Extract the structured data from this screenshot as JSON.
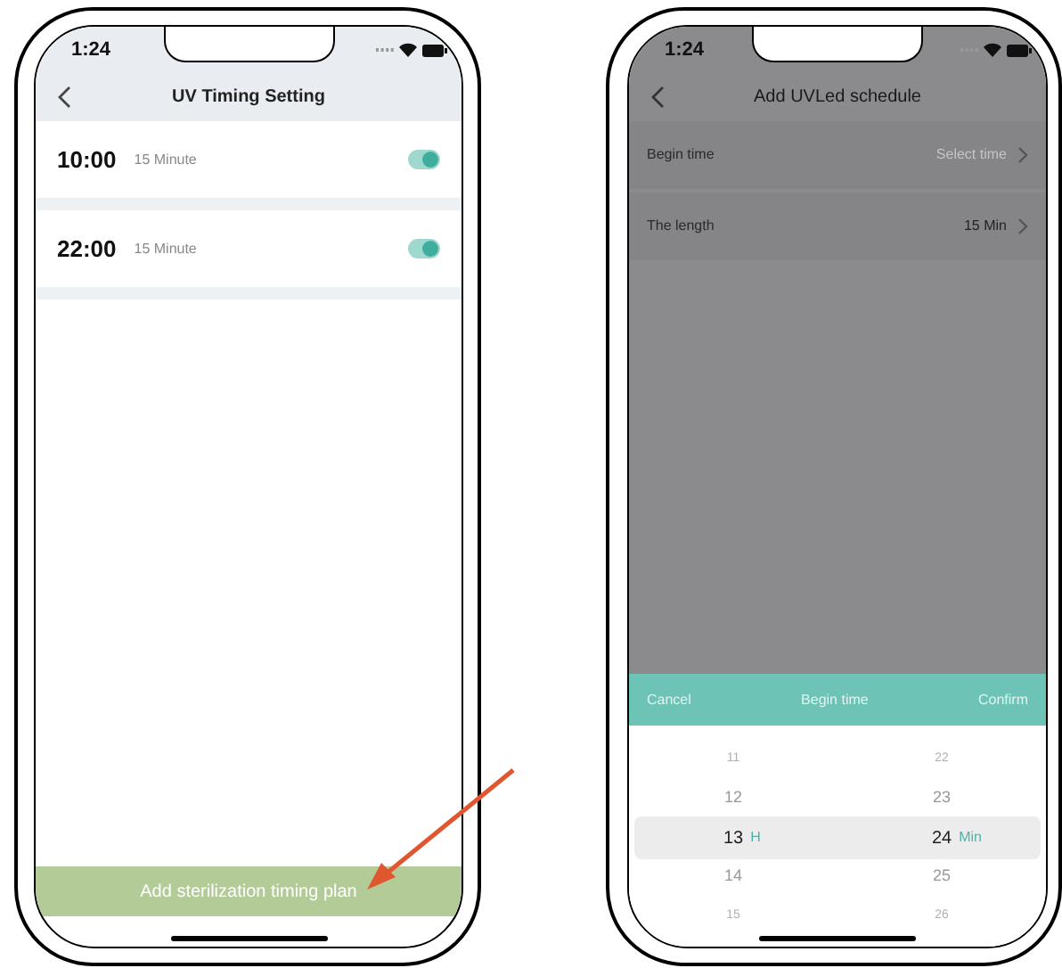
{
  "timing_screen": {
    "status_time": "1:24",
    "title": "UV Timing Setting",
    "schedules": [
      {
        "time": "10:00",
        "duration": "15 Minute",
        "on": true
      },
      {
        "time": "22:00",
        "duration": "15 Minute",
        "on": true
      }
    ],
    "add_button": "Add sterilization timing plan"
  },
  "schedule_screen": {
    "status_time": "1:24",
    "title": "Add UVLed schedule",
    "rows": [
      {
        "label": "Begin time",
        "value": "Select time",
        "placeholder": true
      },
      {
        "label": "The length",
        "value": "15 Min",
        "placeholder": false
      }
    ],
    "picker": {
      "cancel": "Cancel",
      "title": "Begin time",
      "confirm": "Confirm",
      "columns": [
        {
          "unit": "H",
          "items": [
            {
              "label": "11",
              "selected": false
            },
            {
              "label": "12",
              "selected": false
            },
            {
              "label": "13",
              "selected": true
            },
            {
              "label": "14",
              "selected": false
            },
            {
              "label": "15",
              "selected": false
            }
          ]
        },
        {
          "unit": "Min",
          "items": [
            {
              "label": "22",
              "selected": false
            },
            {
              "label": "23",
              "selected": false
            },
            {
              "label": "24",
              "selected": true
            },
            {
              "label": "25",
              "selected": false
            },
            {
              "label": "26",
              "selected": false
            }
          ]
        }
      ]
    }
  }
}
